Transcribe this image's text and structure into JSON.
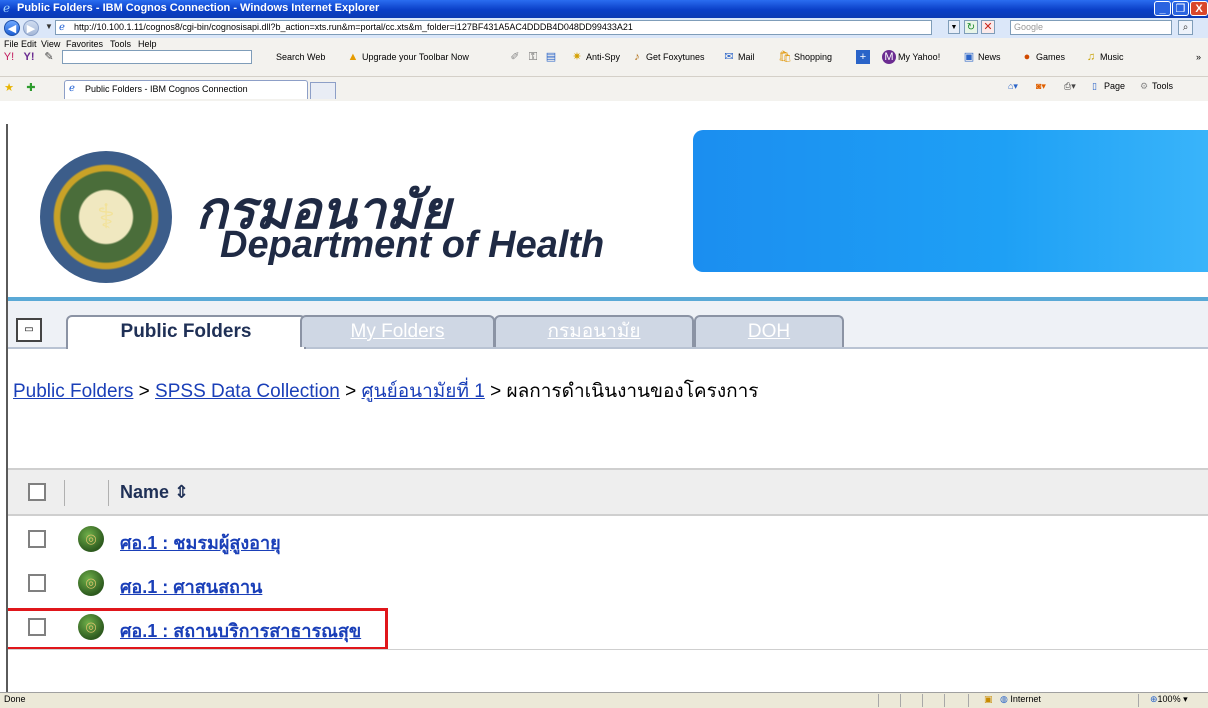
{
  "window": {
    "title": "Public Folders - IBM Cognos Connection - Windows Internet Explorer",
    "min": "_",
    "max": "❐",
    "close": "X"
  },
  "address": {
    "url": "http://10.100.1.11/cognos8/cgi-bin/cognosisapi.dll?b_action=xts.run&m=portal/cc.xts&m_folder=i127BF431A5AC4DDDB4D048DD99433A21",
    "search_placeholder": "Google"
  },
  "menu": [
    "File",
    "Edit",
    "View",
    "Favorites",
    "Tools",
    "Help"
  ],
  "yahoo_toolbar": {
    "search_web": "Search Web",
    "upgrade": "Upgrade your Toolbar Now",
    "antispy": "Anti-Spy",
    "foxytunes": "Get Foxytunes",
    "mail": "Mail",
    "shopping": "Shopping",
    "my_yahoo": "My Yahoo!",
    "news": "News",
    "games": "Games",
    "music": "Music",
    "more": "»"
  },
  "ie_tab": {
    "label": "Public Folders - IBM Cognos Connection"
  },
  "command_bar": {
    "page": "Page",
    "tools": "Tools"
  },
  "header": {
    "thai_title": "กรมอนามัย",
    "english_title": "Department of Health"
  },
  "portal_tabs": [
    {
      "label": "Public Folders"
    },
    {
      "label": "My Folders"
    },
    {
      "label": "กรมอนามัย"
    },
    {
      "label": "DOH"
    }
  ],
  "breadcrumb": {
    "items": [
      "Public Folders",
      "SPSS Data Collection",
      "ศูนย์อนามัยที่ 1"
    ],
    "current": "ผลการดำเนินงานของโครงการ",
    "sep": " > "
  },
  "list": {
    "name_header": "Name ⇕",
    "rows": [
      {
        "label": "ศอ.1 : ชมรมผู้สูงอายุ"
      },
      {
        "label": "ศอ.1 : ศาสนสถาน"
      },
      {
        "label": "ศอ.1 : สถานบริการสาธารณสุข"
      }
    ]
  },
  "statusbar": {
    "status": "Done",
    "zone": "Internet",
    "zoom": "100%"
  }
}
